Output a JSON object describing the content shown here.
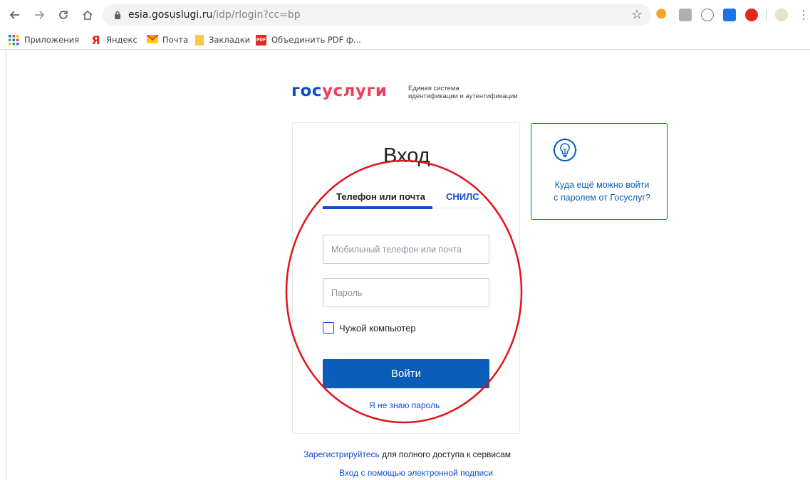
{
  "browser": {
    "url_host": "esia.gosuslugi.ru",
    "url_path": "/idp/rlogin?cc=bp",
    "bookmarks": [
      {
        "label": "Приложения",
        "icon": "apps-grid-icon"
      },
      {
        "label": "Яндекс",
        "icon": "yandex-icon"
      },
      {
        "label": "Почта",
        "icon": "mail-icon"
      },
      {
        "label": "Закладки",
        "icon": "folder-icon"
      },
      {
        "label": "Объединить PDF ф...",
        "icon": "pdf-icon"
      }
    ]
  },
  "logo": {
    "part1": "гос",
    "part2": "услуги",
    "subtitle_line1": "Единая система",
    "subtitle_line2": "идентификации и аутентификации"
  },
  "login": {
    "title": "Вход",
    "tab_phone": "Телефон или почта",
    "tab_snils": "СНИЛС",
    "login_placeholder": "Мобильный телефон или почта",
    "password_placeholder": "Пароль",
    "checkbox_label": "Чужой компьютер",
    "submit": "Войти",
    "forgot": "Я не знаю пароль"
  },
  "footer": {
    "register_link": "Зарегистрируйтесь",
    "register_rest": " для полного доступа к сервисам",
    "esign": "Вход с помощью электронной подписи"
  },
  "info": {
    "icon": "lightbulb-icon",
    "line1": "Куда ещё можно войти",
    "line2": "с паролем от Госуслуг?"
  },
  "colors": {
    "accent": "#0d4cd3",
    "button": "#0a5db8",
    "brand_red": "#ee3f58",
    "annotation": "#e0141b"
  }
}
